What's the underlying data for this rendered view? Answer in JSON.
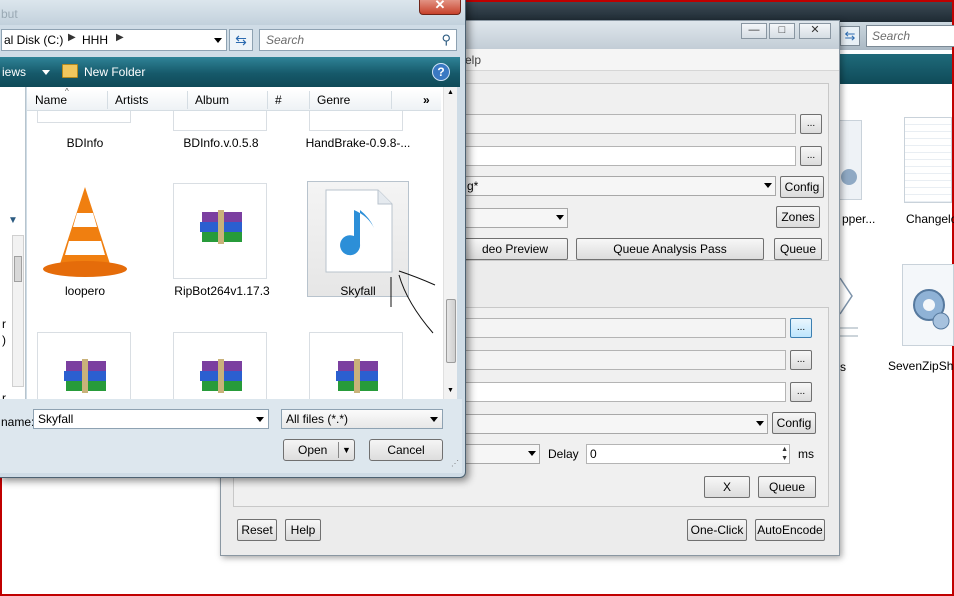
{
  "background_window": {
    "search_placeholder": "Search",
    "items": [
      {
        "label": "pper..."
      },
      {
        "label": "Changelo"
      },
      {
        "label": "s"
      },
      {
        "label": "SevenZipSha"
      }
    ]
  },
  "encoder_window": {
    "menu_fragment": "elp",
    "first_combo_value": "g*",
    "buttons": {
      "browse": "...",
      "config": "Config",
      "zones": "Zones",
      "video_preview": "deo Preview",
      "queue_analysis": "Queue Analysis Pass",
      "queue": "Queue",
      "x": "X",
      "reset": "Reset",
      "help": "Help",
      "one_click": "One-Click",
      "autoencode": "AutoEncode"
    },
    "delay_label": "Delay",
    "delay_value": "0",
    "delay_unit": "ms"
  },
  "file_dialog": {
    "title_fragment": "but",
    "address": {
      "crumb1": "al Disk (C:)",
      "crumb2": "HHH"
    },
    "search_placeholder": "Search",
    "toolbar": {
      "views": "iews",
      "new_folder": "New Folder"
    },
    "columns": [
      "Name",
      "Artists",
      "Album",
      "#",
      "Genre"
    ],
    "more_columns": "»",
    "files": [
      {
        "label": "BDInfo",
        "icon": "folder-icon"
      },
      {
        "label": "BDInfo.v.0.5.8",
        "icon": "folder-icon"
      },
      {
        "label": "HandBrake-0.9.8-...",
        "icon": "folder-icon"
      },
      {
        "label": "loopero",
        "icon": "vlc-cone-icon"
      },
      {
        "label": "RipBot264v1.17.3",
        "icon": "winrar-archive-icon"
      },
      {
        "label": "Skyfall",
        "icon": "music-note-icon"
      },
      {
        "label": "",
        "icon": "winrar-archive-icon"
      },
      {
        "label": "",
        "icon": "winrar-archive-icon"
      },
      {
        "label": "",
        "icon": "winrar-archive-icon"
      }
    ],
    "filename_label": "name:",
    "filename_value": "Skyfall",
    "filter_value": "All files (*.*)",
    "open_label": "Open",
    "cancel_label": "Cancel",
    "nav_fragments": [
      "r",
      ")",
      "r"
    ]
  }
}
